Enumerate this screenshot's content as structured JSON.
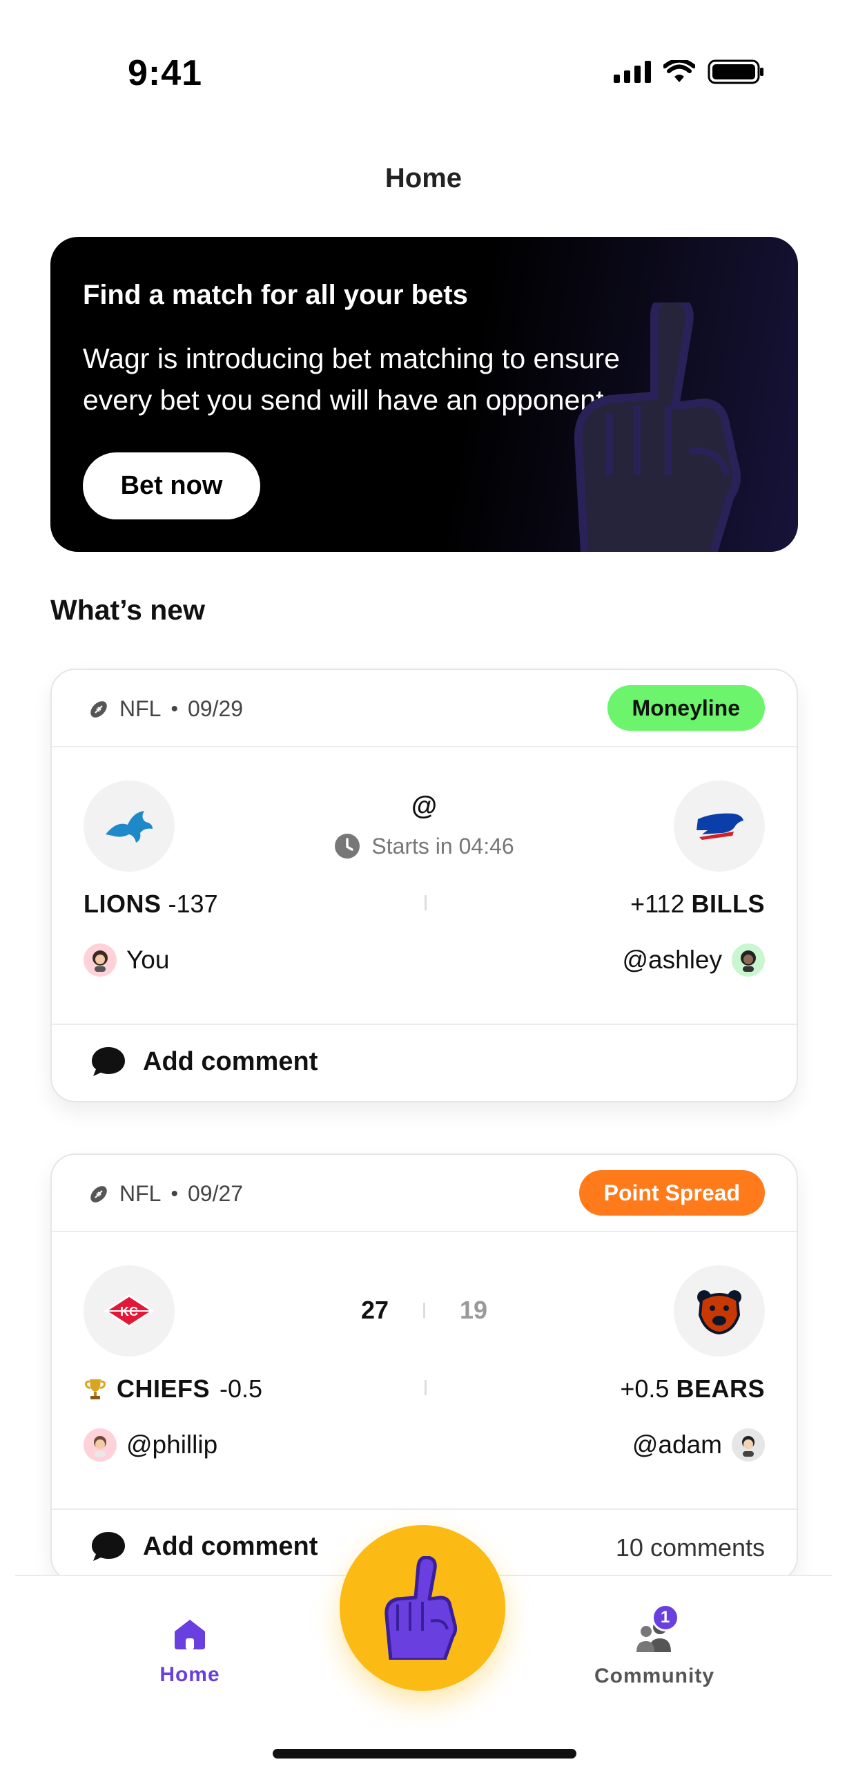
{
  "status_bar": {
    "time": "9:41"
  },
  "header": {
    "title": "Home"
  },
  "promo": {
    "title": "Find a match for all your bets",
    "text": "Wagr is introducing bet matching to ensure every bet you send will have an opponent",
    "button_label": "Bet now"
  },
  "section": {
    "title": "What’s new"
  },
  "bets": [
    {
      "league": "NFL",
      "date": "09/29",
      "bet_type": "Moneyline",
      "bet_type_color": "#6cf56c",
      "status_text": "Starts in 04:46",
      "at_symbol": "@",
      "left": {
        "team": "LIONS",
        "line": "-137",
        "user": "You"
      },
      "right": {
        "team": "BILLS",
        "line": "+112",
        "user": "@ashley"
      },
      "comment_label": "Add comment"
    },
    {
      "league": "NFL",
      "date": "09/27",
      "bet_type": "Point Spread",
      "bet_type_color": "#ff7a1a",
      "left": {
        "team": "CHIEFS",
        "line": "-0.5",
        "user": "@phillip",
        "score": "27",
        "winner": true
      },
      "right": {
        "team": "BEARS",
        "line": "+0.5",
        "user": "@adam",
        "score": "19"
      },
      "comment_label": "Add comment",
      "comment_count": "10 comments"
    }
  ],
  "tabbar": {
    "home_label": "Home",
    "community_label": "Community",
    "community_badge": "1",
    "accent": "#6a3fe0",
    "fab_color": "#fbbb14"
  }
}
